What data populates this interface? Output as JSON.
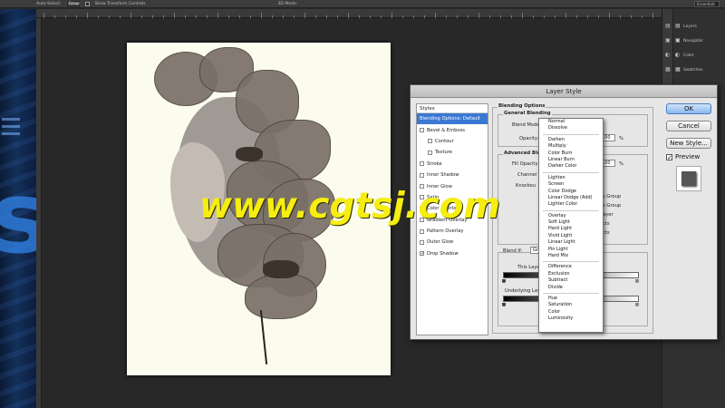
{
  "options_bar": {
    "auto_select_label": "Auto-Select:",
    "auto_select_value": "Group",
    "show_transform_label": "Show Transform Controls",
    "mode_3d_label": "3D Mode:",
    "workspace": "Essentials"
  },
  "right_panels": [
    {
      "label": "Layers",
      "icon": "layers-icon"
    },
    {
      "label": "Navigator",
      "icon": "navigator-icon"
    },
    {
      "label": "Color",
      "icon": "color-icon"
    },
    {
      "label": "Swatches",
      "icon": "swatches-icon"
    }
  ],
  "watermark": "www.cgtsj.com",
  "dialog": {
    "title": "Layer Style",
    "styles_header": "Styles",
    "styles": [
      {
        "label": "Blending Options: Default",
        "checkbox": false,
        "checked": false,
        "selected": true,
        "sub": false
      },
      {
        "label": "Bevel & Emboss",
        "checkbox": true,
        "checked": false,
        "selected": false,
        "sub": false
      },
      {
        "label": "Contour",
        "checkbox": true,
        "checked": false,
        "selected": false,
        "sub": true
      },
      {
        "label": "Texture",
        "checkbox": true,
        "checked": false,
        "selected": false,
        "sub": true
      },
      {
        "label": "Stroke",
        "checkbox": true,
        "checked": false,
        "selected": false,
        "sub": false
      },
      {
        "label": "Inner Shadow",
        "checkbox": true,
        "checked": false,
        "selected": false,
        "sub": false
      },
      {
        "label": "Inner Glow",
        "checkbox": true,
        "checked": false,
        "selected": false,
        "sub": false
      },
      {
        "label": "Satin",
        "checkbox": true,
        "checked": false,
        "selected": false,
        "sub": false
      },
      {
        "label": "Color Overlay",
        "checkbox": true,
        "checked": false,
        "selected": false,
        "sub": false
      },
      {
        "label": "Gradient Overlay",
        "checkbox": true,
        "checked": false,
        "selected": false,
        "sub": false
      },
      {
        "label": "Pattern Overlay",
        "checkbox": true,
        "checked": false,
        "selected": false,
        "sub": false
      },
      {
        "label": "Outer Glow",
        "checkbox": true,
        "checked": false,
        "selected": false,
        "sub": false
      },
      {
        "label": "Drop Shadow",
        "checkbox": true,
        "checked": true,
        "selected": false,
        "sub": false
      }
    ],
    "blending_options_title": "Blending Options",
    "general_blending_title": "General Blending",
    "blend_mode_label": "Blend Mode:",
    "blend_mode_check": "✓",
    "opacity_label": "Opacity:",
    "opacity_value": "100",
    "percent_sign": "%",
    "advanced_title": "Advanced Ble",
    "fill_opacity_label": "Fill Opacity",
    "fill_opacity_value": "100",
    "channels_label": "Channel",
    "knockout_label": "Knockou",
    "behind_options": [
      "s Group",
      "s Group",
      "ayer",
      "cts",
      "cts"
    ],
    "blend_if_label": "Blend If:",
    "blend_if_value": "Gr",
    "this_layer_label": "This Layer",
    "underlying_layer_label": "Underlying Laye",
    "buttons": {
      "ok": "OK",
      "cancel": "Cancel",
      "new_style": "New Style...",
      "preview": "Preview",
      "preview_checked": true
    }
  },
  "blend_modes": [
    [
      "Normal",
      "Dissolve"
    ],
    [
      "Darken",
      "Multiply",
      "Color Burn",
      "Linear Burn",
      "Darker Color"
    ],
    [
      "Lighten",
      "Screen",
      "Color Dodge",
      "Linear Dodge (Add)",
      "Lighter Color"
    ],
    [
      "Overlay",
      "Soft Light",
      "Hard Light",
      "Vivid Light",
      "Linear Light",
      "Pin Light",
      "Hard Mix"
    ],
    [
      "Difference",
      "Exclusion",
      "Subtract",
      "Divide"
    ],
    [
      "Hue",
      "Saturation",
      "Color",
      "Luminosity"
    ]
  ]
}
